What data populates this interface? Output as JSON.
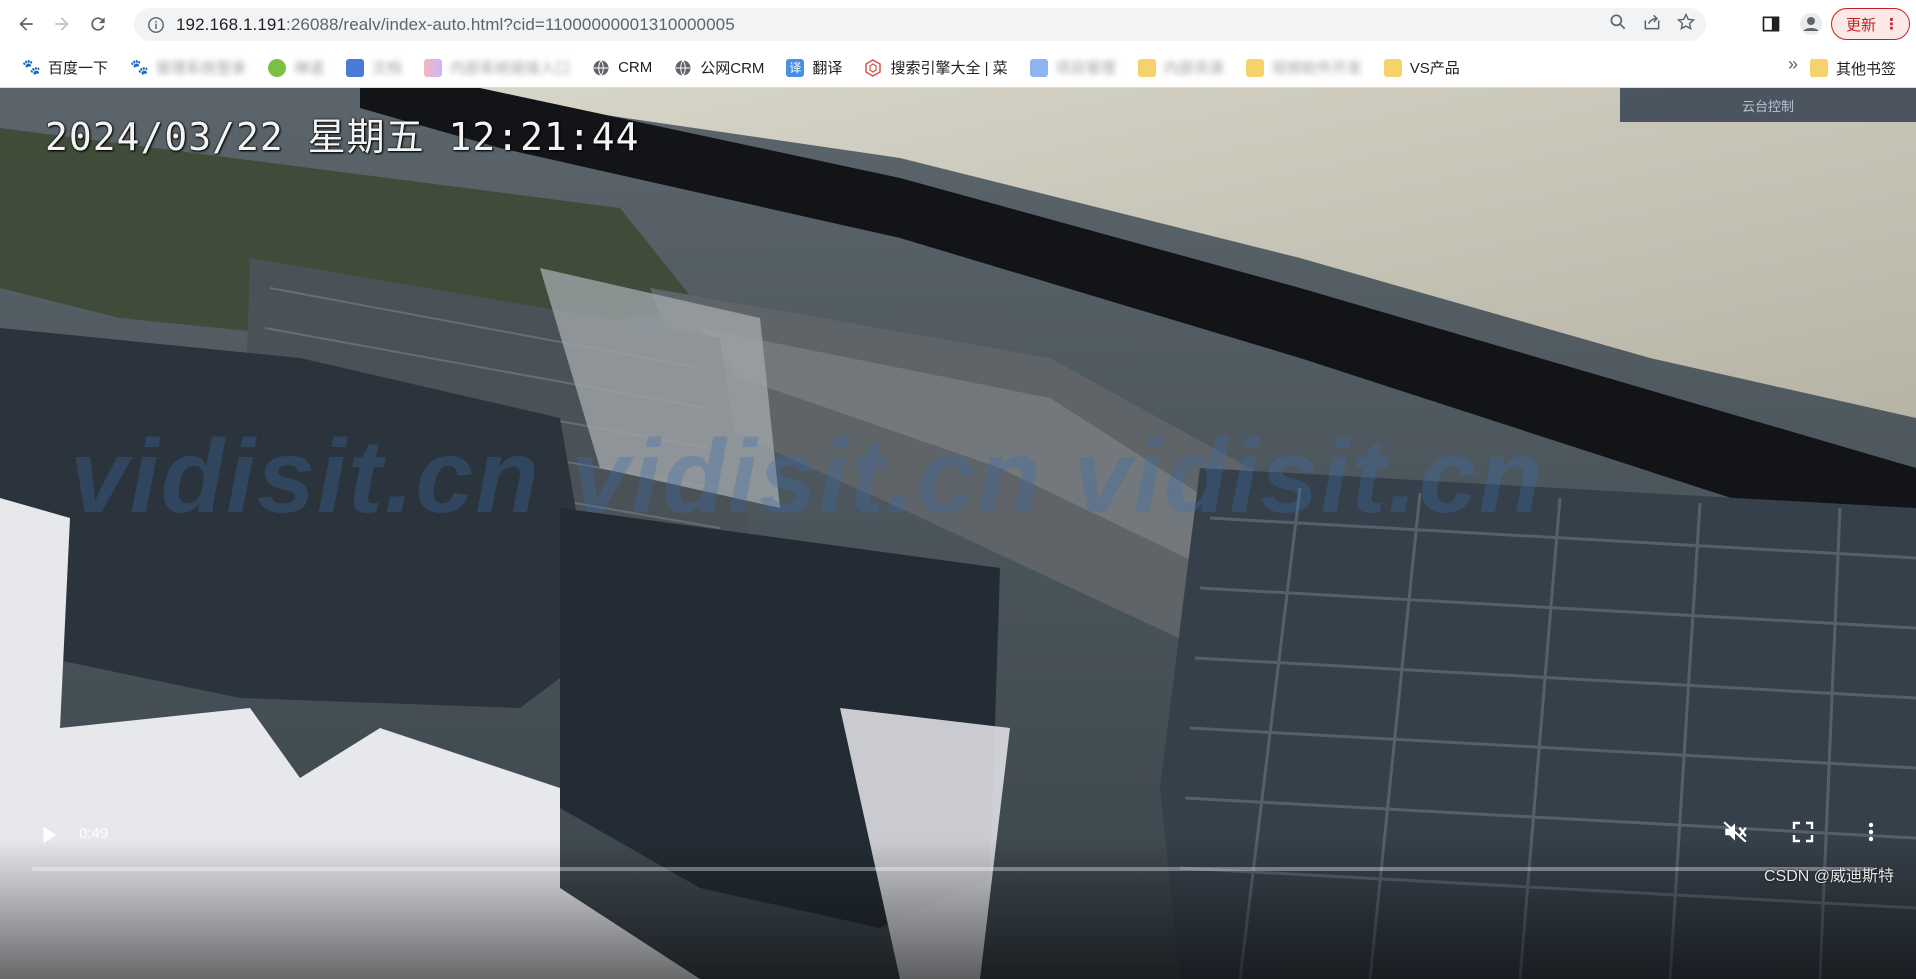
{
  "browser": {
    "url_host": "192.168.1.191",
    "url_rest": ":26088/realv/index-auto.html?cid=11000000001310000005",
    "update_label": "更新"
  },
  "bookmarks": {
    "items": [
      {
        "label": "百度一下",
        "icon": "baidu-paw-icon",
        "blurred": false
      },
      {
        "label": "管理系统登录",
        "icon": "baidu-paw-icon",
        "blurred": true
      },
      {
        "label": "禅道",
        "icon": "green-leaf-icon",
        "blurred": true
      },
      {
        "label": "文档",
        "icon": "blue-shield-icon",
        "blurred": true
      },
      {
        "label": "内部系统链接入口",
        "icon": "colorful-icon",
        "blurred": true
      },
      {
        "label": "CRM",
        "icon": "globe-icon",
        "blurred": false
      },
      {
        "label": "公网CRM",
        "icon": "globe-icon",
        "blurred": false
      },
      {
        "label": "翻译",
        "icon": "translate-icon",
        "blurred": false
      },
      {
        "label": "搜索引擎大全 | 菜",
        "icon": "search-engine-icon",
        "blurred": false
      },
      {
        "label": "项目管理",
        "icon": "blue-doc-icon",
        "blurred": true
      },
      {
        "label": "内部资源",
        "icon": "folder-icon",
        "blurred": true
      },
      {
        "label": "视频软件开发",
        "icon": "folder-icon",
        "blurred": true
      },
      {
        "label": "VS产品",
        "icon": "folder-icon",
        "blurred": false
      }
    ],
    "more": "»",
    "other": "其他书签"
  },
  "video": {
    "timestamp": "2024/03/22 星期五 12:21:44",
    "ptz_label": "云台控制",
    "watermark": "vidisit.cn  vidisit.cn  vidisit.cn",
    "time": "0:49",
    "progress": 0.0,
    "credit": "CSDN @威迪斯特"
  },
  "colors": {
    "accent_update": "#c5221f",
    "ptz_bg": "#283446",
    "watermark": "#3c6eaa"
  }
}
